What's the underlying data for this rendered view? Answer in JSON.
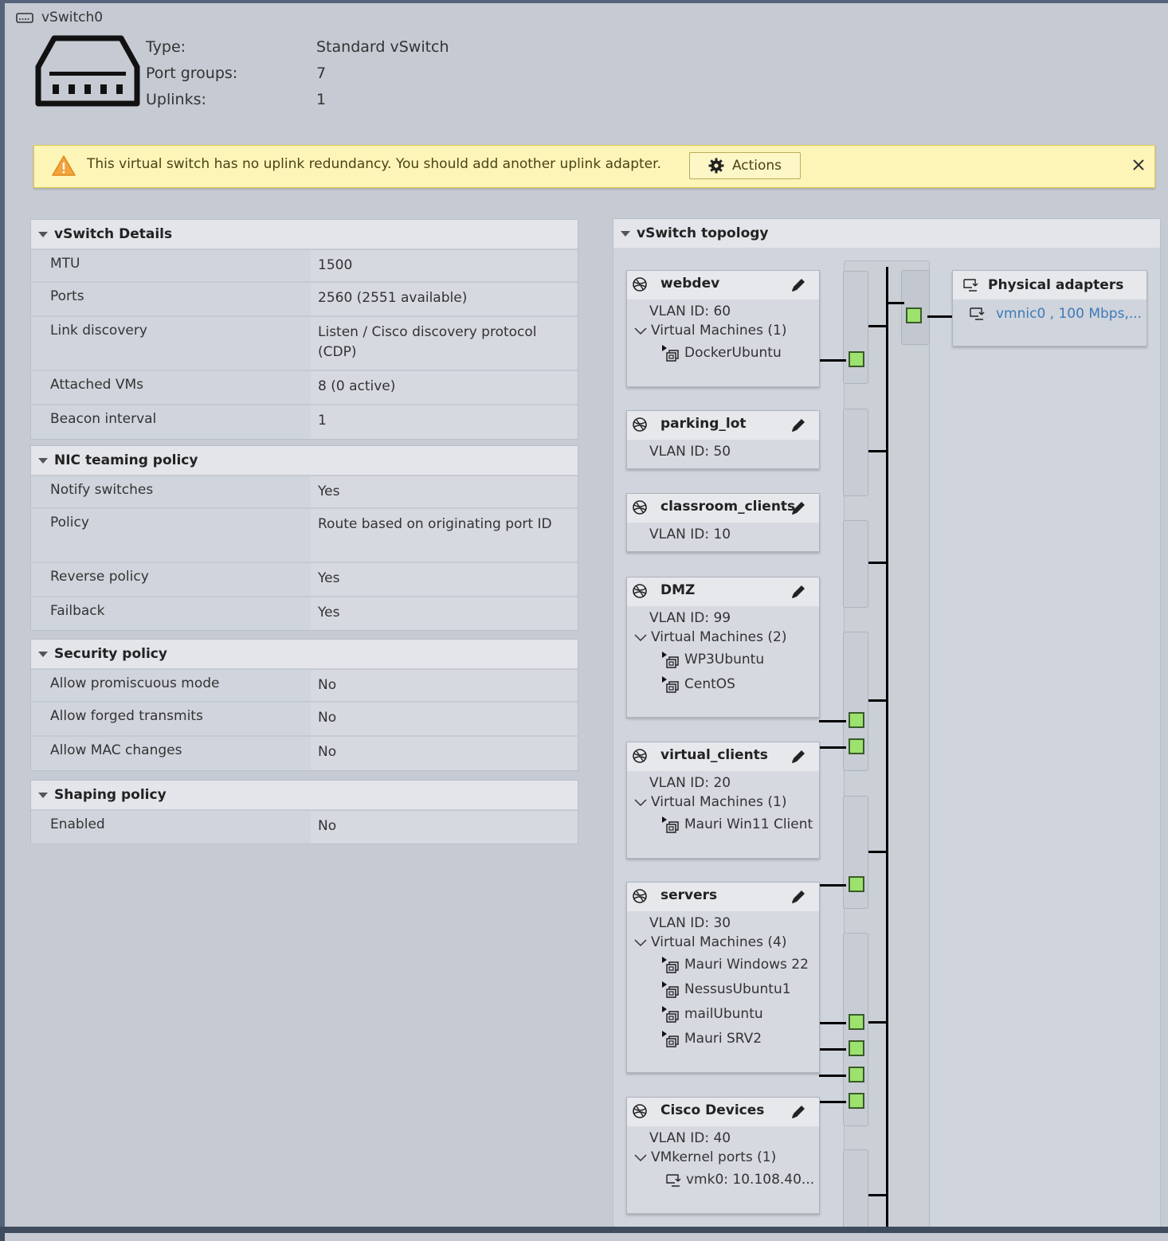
{
  "window": {
    "title": "vSwitch0"
  },
  "summary": [
    {
      "key": "Type:",
      "value": "Standard vSwitch"
    },
    {
      "key": "Port groups:",
      "value": "7"
    },
    {
      "key": "Uplinks:",
      "value": "1"
    }
  ],
  "banner": {
    "message": "This virtual switch has no uplink redundancy. You should add another uplink adapter.",
    "actions_label": "Actions"
  },
  "sections": [
    {
      "title": "vSwitch Details",
      "rows": [
        {
          "key": "MTU",
          "value": "1500"
        },
        {
          "key": "Ports",
          "value": "2560 (2551 available)"
        },
        {
          "key": "Link discovery",
          "value": "Listen / Cisco discovery protocol (CDP)"
        },
        {
          "key": "Attached VMs",
          "value": "8 (0 active)"
        },
        {
          "key": "Beacon interval",
          "value": "1"
        }
      ]
    },
    {
      "title": "NIC teaming policy",
      "rows": [
        {
          "key": "Notify switches",
          "value": "Yes"
        },
        {
          "key": "Policy",
          "value": "Route based on originating port ID"
        },
        {
          "key": "Reverse policy",
          "value": "Yes"
        },
        {
          "key": "Failback",
          "value": "Yes"
        }
      ]
    },
    {
      "title": "Security policy",
      "rows": [
        {
          "key": "Allow promiscuous mode",
          "value": "No"
        },
        {
          "key": "Allow forged transmits",
          "value": "No"
        },
        {
          "key": "Allow MAC changes",
          "value": "No"
        }
      ]
    },
    {
      "title": "Shaping policy",
      "rows": [
        {
          "key": "Enabled",
          "value": "No"
        }
      ]
    }
  ],
  "topology": {
    "title": "vSwitch topology",
    "portgroups": [
      {
        "name": "webdev",
        "vlan": "VLAN ID: 60",
        "section": "Virtual Machines (1)",
        "items": [
          "DockerUbuntu"
        ]
      },
      {
        "name": "parking_lot",
        "vlan": "VLAN ID: 50",
        "section": "",
        "items": []
      },
      {
        "name": "classroom_clients",
        "vlan": "VLAN ID: 10",
        "section": "",
        "items": []
      },
      {
        "name": "DMZ",
        "vlan": "VLAN ID: 99",
        "section": "Virtual Machines (2)",
        "items": [
          "WP3Ubuntu",
          "CentOS"
        ]
      },
      {
        "name": "virtual_clients",
        "vlan": "VLAN ID: 20",
        "section": "Virtual Machines (1)",
        "items": [
          "Mauri Win11 Client"
        ]
      },
      {
        "name": "servers",
        "vlan": "VLAN ID: 30",
        "section": "Virtual Machines (4)",
        "items": [
          "Mauri Windows 22",
          "NessusUbuntu1",
          "mailUbuntu",
          "Mauri SRV2"
        ]
      },
      {
        "name": "Cisco Devices",
        "vlan": "VLAN ID: 40",
        "section": "VMkernel ports (1)",
        "items": [
          "vmk0: 10.108.40..."
        ]
      }
    ],
    "physical_adapters": {
      "title": "Physical adapters",
      "nic": "vmnic0 , 100 Mbps,..."
    }
  }
}
